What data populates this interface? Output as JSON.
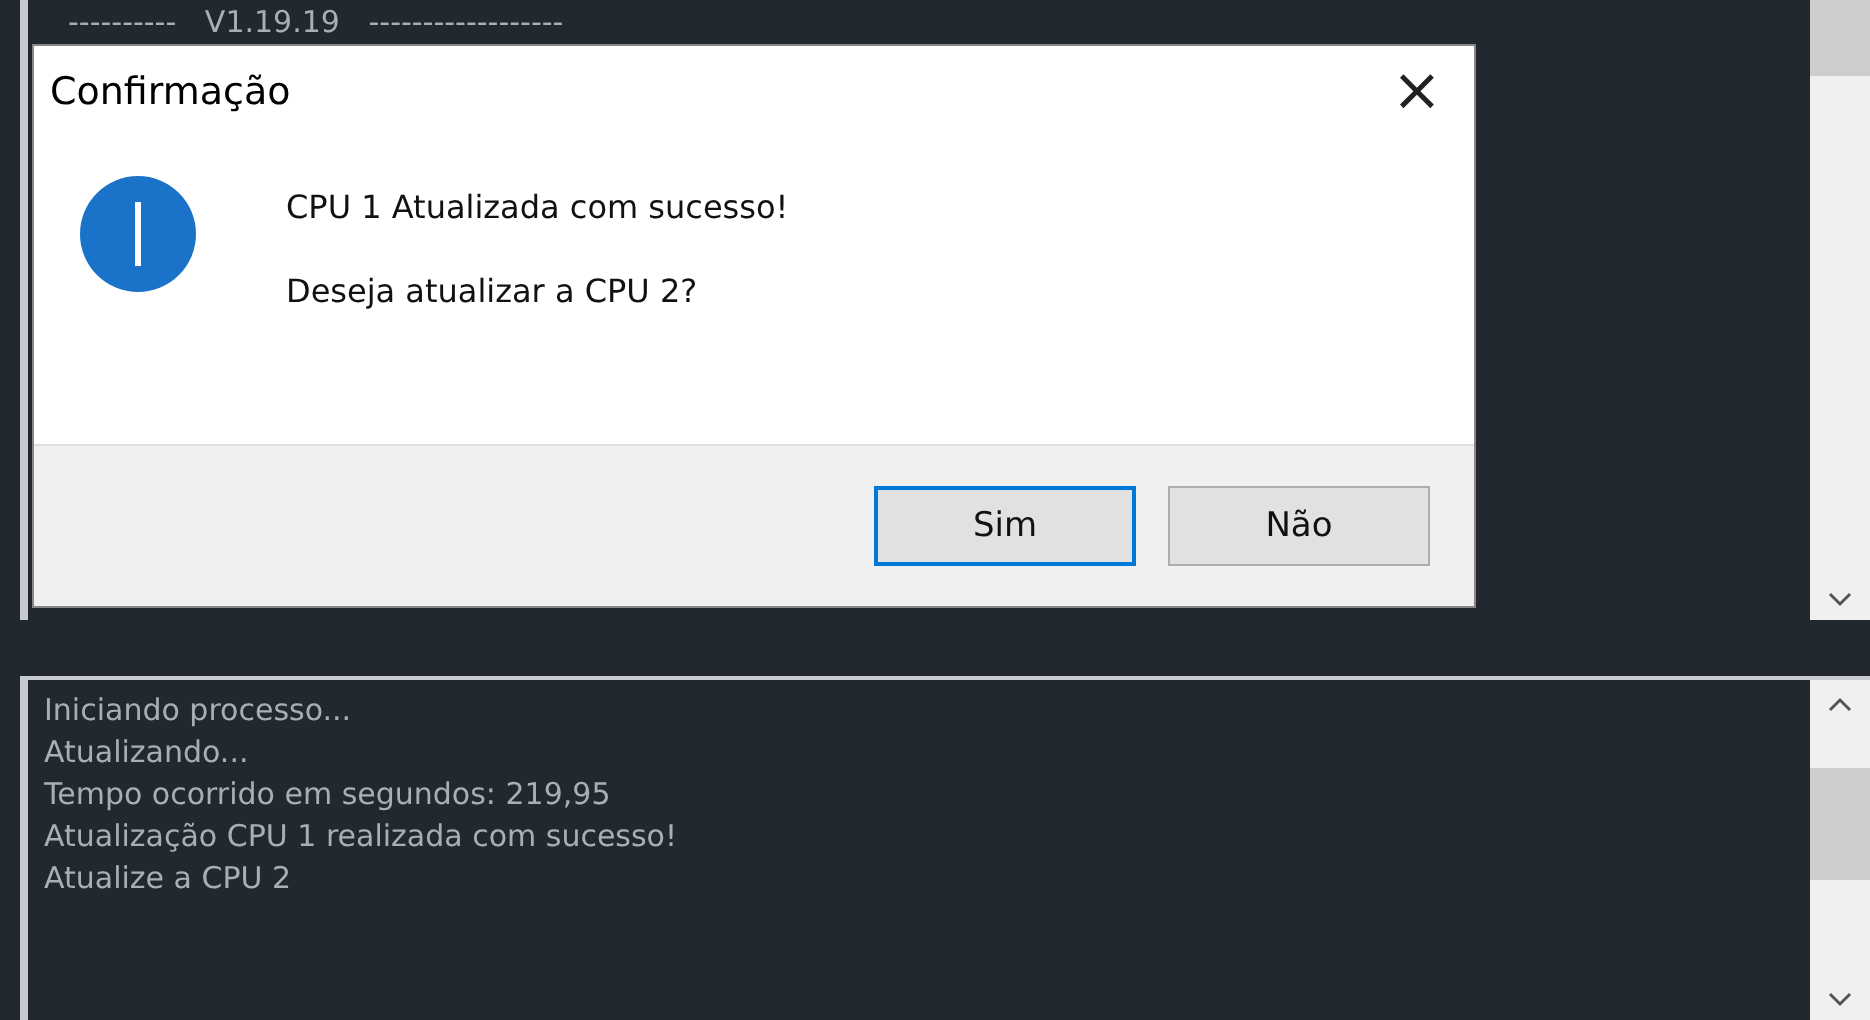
{
  "top_log": {
    "lines": [
      "----------   V1.19.19   ------------------"
    ]
  },
  "dialog": {
    "title": "Confirmação",
    "close": "×",
    "messages": [
      "CPU 1 Atualizada com sucesso!",
      "Deseja atualizar a CPU 2?"
    ],
    "buttons": [
      {
        "label": "Sim",
        "selected": true
      },
      {
        "label": "Não",
        "selected": false
      }
    ]
  },
  "bottom_log": {
    "lines": [
      "Iniciando processo...",
      "Atualizando...",
      "Tempo ocorrido em segundos: 219,95",
      "Atualização CPU 1 realizada com sucesso!",
      "Atualize a CPU 2"
    ]
  }
}
